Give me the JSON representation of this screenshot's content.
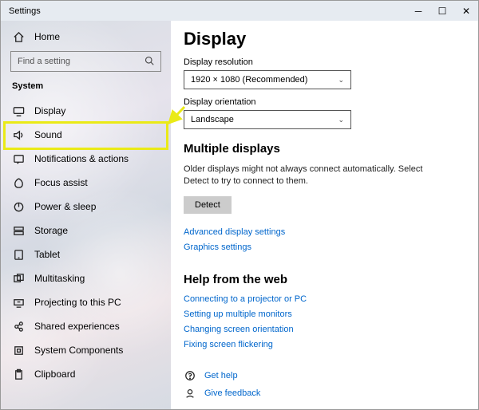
{
  "window": {
    "title": "Settings"
  },
  "sidebar": {
    "home": "Home",
    "search_placeholder": "Find a setting",
    "section": "System",
    "items": [
      {
        "label": "Display"
      },
      {
        "label": "Sound"
      },
      {
        "label": "Notifications & actions"
      },
      {
        "label": "Focus assist"
      },
      {
        "label": "Power & sleep"
      },
      {
        "label": "Storage"
      },
      {
        "label": "Tablet"
      },
      {
        "label": "Multitasking"
      },
      {
        "label": "Projecting to this PC"
      },
      {
        "label": "Shared experiences"
      },
      {
        "label": "System Components"
      },
      {
        "label": "Clipboard"
      }
    ]
  },
  "main": {
    "title": "Display",
    "resolution_label": "Display resolution",
    "resolution_value": "1920 × 1080 (Recommended)",
    "orientation_label": "Display orientation",
    "orientation_value": "Landscape",
    "multi_title": "Multiple displays",
    "multi_desc": "Older displays might not always connect automatically. Select Detect to try to connect to them.",
    "detect_label": "Detect",
    "adv_link": "Advanced display settings",
    "gfx_link": "Graphics settings",
    "help_title": "Help from the web",
    "help_links": [
      "Connecting to a projector or PC",
      "Setting up multiple monitors",
      "Changing screen orientation",
      "Fixing screen flickering"
    ],
    "get_help": "Get help",
    "give_feedback": "Give feedback"
  }
}
